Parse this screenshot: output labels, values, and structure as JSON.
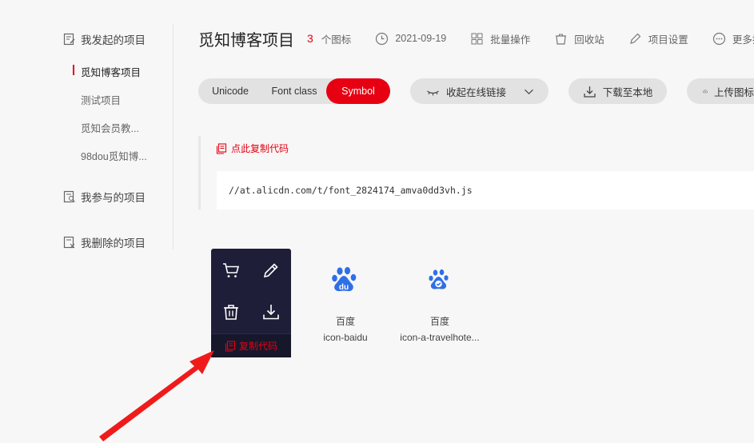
{
  "sidebar": {
    "my_projects": "我发起的项目",
    "projects": [
      "觅知博客项目",
      "测试项目",
      "觅知会员教...",
      "98dou觅知博..."
    ],
    "joined": "我参与的项目",
    "deleted": "我删除的项目"
  },
  "header": {
    "title": "觅知博客项目",
    "icon_count": "3",
    "icon_count_label": "个图标",
    "date": "2021-09-19",
    "batch": "批量操作",
    "recycle": "回收站",
    "settings": "项目设置",
    "more": "更多操"
  },
  "toolbar": {
    "tabs": [
      "Unicode",
      "Font class",
      "Symbol"
    ],
    "active_tab": "Symbol",
    "online_link": "收起在线链接",
    "download": "下载至本地",
    "upload": "上传图标"
  },
  "code": {
    "copy_label": "点此复制代码",
    "url": "//at.alicdn.com/t/font_2824174_amva0dd3vh.js"
  },
  "icons": [
    {
      "name": "百度",
      "code": "icon-baidu",
      "glyph": "baidu-paw-icon"
    },
    {
      "name": "百度",
      "code": "icon-a-travelhote...",
      "glyph": "baidu-travel-paw-icon"
    }
  ],
  "overlay": {
    "copy_code": "复制代码"
  },
  "colors": {
    "accent": "#e60012",
    "baidu_blue": "#2f6fe6",
    "overlay_bg": "#1e1e38"
  }
}
